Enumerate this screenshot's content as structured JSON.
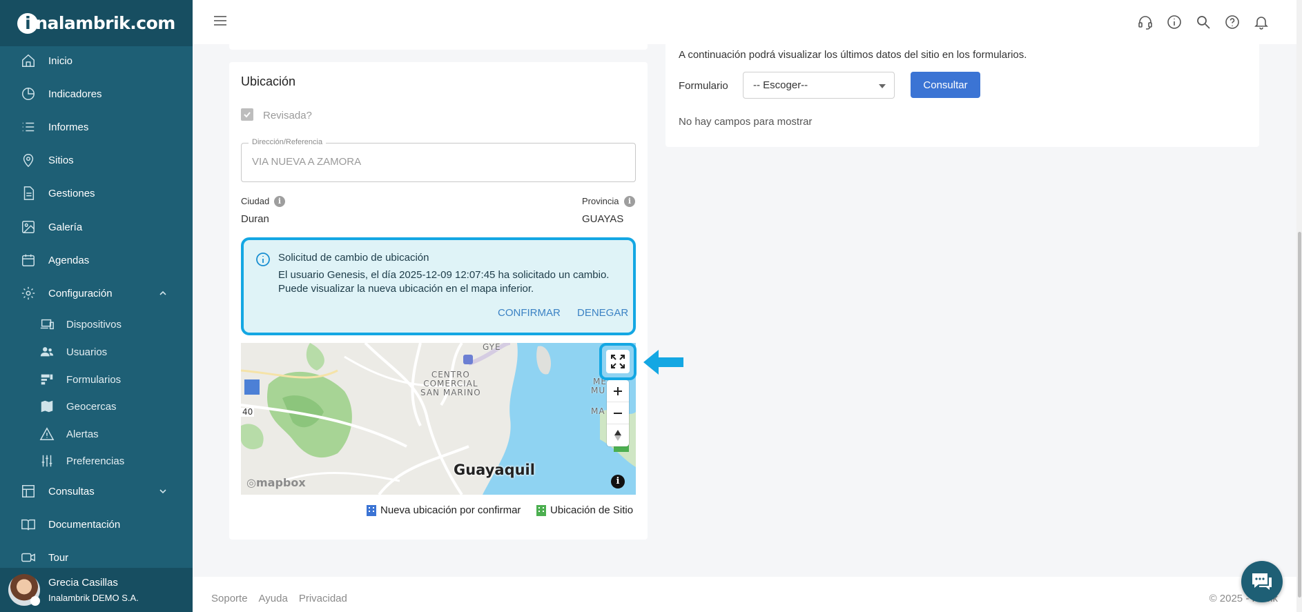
{
  "brand": {
    "logo_text": "nalambrik.com",
    "logo_i": "i"
  },
  "sidebar": {
    "items": [
      {
        "label": "Inicio",
        "icon": "home-icon"
      },
      {
        "label": "Indicadores",
        "icon": "pie-chart-icon"
      },
      {
        "label": "Informes",
        "icon": "list-icon"
      },
      {
        "label": "Sitios",
        "icon": "map-pin-icon"
      },
      {
        "label": "Gestiones",
        "icon": "document-icon"
      },
      {
        "label": "Galería",
        "icon": "image-icon"
      },
      {
        "label": "Agendas",
        "icon": "calendar-icon"
      },
      {
        "label": "Configuración",
        "icon": "gear-icon",
        "expanded": true
      },
      {
        "label": "Consultas",
        "icon": "table-icon",
        "expanded": false
      },
      {
        "label": "Documentación",
        "icon": "book-icon"
      },
      {
        "label": "Tour",
        "icon": "video-icon"
      }
    ],
    "config_sub": [
      {
        "label": "Dispositivos",
        "icon": "devices-icon"
      },
      {
        "label": "Usuarios",
        "icon": "users-icon"
      },
      {
        "label": "Formularios",
        "icon": "forms-icon"
      },
      {
        "label": "Geocercas",
        "icon": "map-icon"
      },
      {
        "label": "Alertas",
        "icon": "warning-icon"
      },
      {
        "label": "Preferencias",
        "icon": "sliders-icon"
      }
    ],
    "user": {
      "name": "Grecia Casillas",
      "org": "Inalambrik DEMO S.A."
    }
  },
  "ubicacion": {
    "title": "Ubicación",
    "checkbox_label": "Revisada?",
    "checked": true,
    "direccion_label": "Dirección/Referencia",
    "direccion_value": "VIA NUEVA A ZAMORA",
    "ciudad_label": "Ciudad",
    "ciudad_value": "Duran",
    "provincia_label": "Provincia",
    "provincia_value": "GUAYAS",
    "alert": {
      "title": "Solicitud de cambio de ubicación",
      "body": "El usuario Genesis, el día 2025-12-09 12:07:45 ha solicitado un cambio. Puede visualizar la nueva ubicación en el mapa inferior.",
      "confirm": "CONFIRMAR",
      "deny": "DENEGAR"
    },
    "map": {
      "city_label": "Guayaquil",
      "area_label": "CENTRO COMERCIAL SAN MARINO",
      "area_line1": "CENTRO",
      "area_line2": "COMERCIAL",
      "area_line3": "SAN MARINO",
      "gye_label": "GYE",
      "road_label": "40",
      "edge_label1": "ME",
      "edge_label2": "MU PA",
      "edge_label3": "MA",
      "provider": "mapbox"
    },
    "legend": {
      "new_location": "Nueva ubicación por confirmar",
      "site_location": "Ubicación de Sitio"
    }
  },
  "right_panel": {
    "description": "A continuación podrá visualizar los últimos datos del sitio en los formularios.",
    "form_label": "Formulario",
    "select_value": "-- Escoger--",
    "button": "Consultar",
    "empty": "No hay campos para mostrar"
  },
  "footer": {
    "links": [
      "Soporte",
      "Ayuda",
      "Privacidad"
    ],
    "copyright": "© 2025 - Rocik"
  },
  "colors": {
    "sidebar": "#1e5f75",
    "accent": "#14a7e3",
    "primary_button": "#3b74d4",
    "new_location_icon": "#3b74d4",
    "site_location_icon": "#4caf50"
  }
}
